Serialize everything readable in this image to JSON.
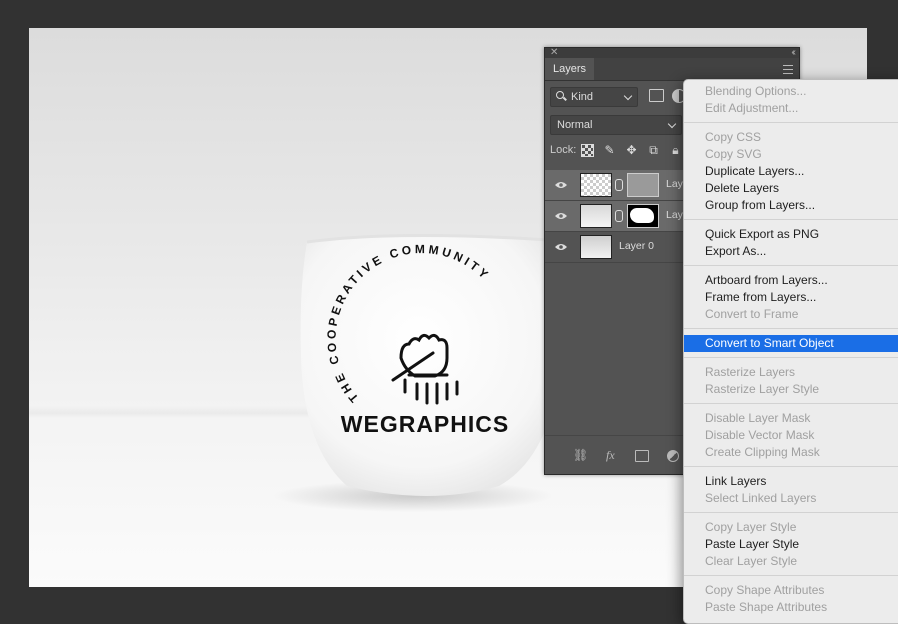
{
  "panel": {
    "title": "Layers",
    "kind_filter": "Kind",
    "blend_mode": "Normal",
    "lock_label": "Lock:"
  },
  "layers": [
    {
      "name": "Layer",
      "visible": true,
      "selected": false
    },
    {
      "name": "Layer",
      "visible": true,
      "selected": false
    },
    {
      "name": "Layer 0",
      "visible": true,
      "selected": false
    }
  ],
  "footer": {
    "fx_label": "fx"
  },
  "mug": {
    "arc_text": "THE COOPERATIVE COMMUNITY",
    "brand": "WEGRAPHICS"
  },
  "context_menu": {
    "groups": [
      [
        {
          "label": "Blending Options...",
          "disabled": true
        },
        {
          "label": "Edit Adjustment...",
          "disabled": true
        }
      ],
      [
        {
          "label": "Copy CSS",
          "disabled": true
        },
        {
          "label": "Copy SVG",
          "disabled": true
        },
        {
          "label": "Duplicate Layers...",
          "disabled": false
        },
        {
          "label": "Delete Layers",
          "disabled": false
        },
        {
          "label": "Group from Layers...",
          "disabled": false
        }
      ],
      [
        {
          "label": "Quick Export as PNG",
          "disabled": false
        },
        {
          "label": "Export As...",
          "disabled": false
        }
      ],
      [
        {
          "label": "Artboard from Layers...",
          "disabled": false
        },
        {
          "label": "Frame from Layers...",
          "disabled": false
        },
        {
          "label": "Convert to Frame",
          "disabled": true
        }
      ],
      [
        {
          "label": "Convert to Smart Object",
          "disabled": false,
          "highlighted": true
        }
      ],
      [
        {
          "label": "Rasterize Layers",
          "disabled": true
        },
        {
          "label": "Rasterize Layer Style",
          "disabled": true
        }
      ],
      [
        {
          "label": "Disable Layer Mask",
          "disabled": true
        },
        {
          "label": "Disable Vector Mask",
          "disabled": true
        },
        {
          "label": "Create Clipping Mask",
          "disabled": true
        }
      ],
      [
        {
          "label": "Link Layers",
          "disabled": false
        },
        {
          "label": "Select Linked Layers",
          "disabled": true
        }
      ],
      [
        {
          "label": "Copy Layer Style",
          "disabled": true
        },
        {
          "label": "Paste Layer Style",
          "disabled": false
        },
        {
          "label": "Clear Layer Style",
          "disabled": true
        }
      ],
      [
        {
          "label": "Copy Shape Attributes",
          "disabled": true
        },
        {
          "label": "Paste Shape Attributes",
          "disabled": true
        }
      ]
    ]
  },
  "colors": {
    "workspace": "#323232",
    "panel": "#535353",
    "menu_bg": "#ececec",
    "menu_highlight": "#1a6ee6"
  }
}
